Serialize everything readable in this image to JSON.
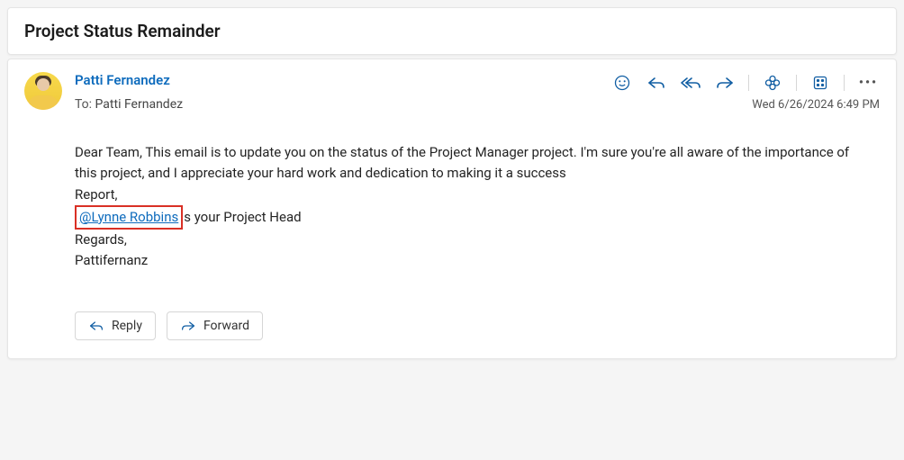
{
  "subject": "Project Status Remainder",
  "from": "Patti Fernandez",
  "to_label": "To:",
  "to_value": "Patti Fernandez",
  "date": "Wed 6/26/2024 6:49 PM",
  "body": {
    "p1": "Dear Team, This email is to update you on the status of the Project Manager project. I'm sure you're all aware of the importance of this project, and I appreciate your hard work and dedication to making it a success",
    "line2": "Report,",
    "mention": "@Lynne Robbins",
    "mention_tail": "s your Project Head",
    "regards": "Regards,",
    "signoff": "Pattifernanz"
  },
  "buttons": {
    "reply": "Reply",
    "forward": "Forward"
  },
  "icons": {
    "react": "react",
    "reply": "reply",
    "reply_all": "reply-all",
    "forward": "forward",
    "clover": "copilot",
    "apps": "apps",
    "more": "•••"
  }
}
